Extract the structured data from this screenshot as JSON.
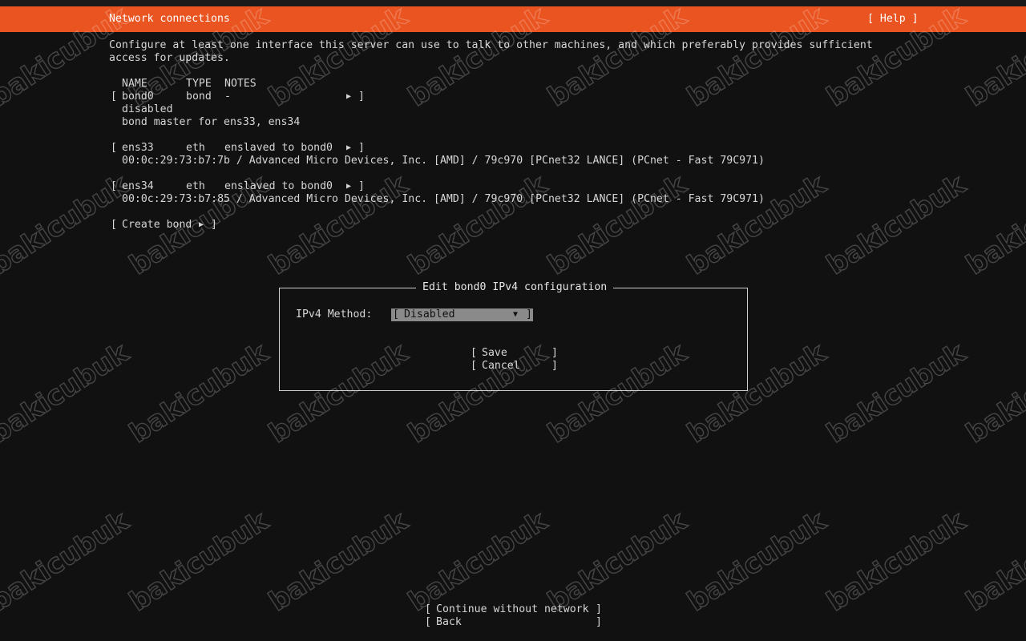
{
  "header": {
    "title": "Network connections",
    "help": "[ Help ]"
  },
  "intro": {
    "line1": "Configure at least one interface this server can use to talk to other machines, and which preferably provides sufficient",
    "line2": "access for updates."
  },
  "columns": {
    "name": "NAME",
    "type": "TYPE",
    "notes": "NOTES"
  },
  "interfaces": [
    {
      "name": "bond0",
      "type": "bond",
      "notes": "-",
      "status": "disabled",
      "detail": "bond master for ens33, ens34"
    },
    {
      "name": "ens33",
      "type": "eth",
      "notes": "enslaved to bond0",
      "detail": "00:0c:29:73:b7:7b / Advanced Micro Devices, Inc. [AMD] / 79c970 [PCnet32 LANCE] (PCnet - Fast 79C971)"
    },
    {
      "name": "ens34",
      "type": "eth",
      "notes": "enslaved to bond0",
      "detail": "00:0c:29:73:b7:85 / Advanced Micro Devices, Inc. [AMD] / 79c970 [PCnet32 LANCE] (PCnet - Fast 79C971)"
    }
  ],
  "create_bond": "Create bond",
  "dialog": {
    "title": "Edit bond0 IPv4 configuration",
    "method_label": "IPv4 Method:",
    "method_value": "Disabled",
    "save_label": "Save",
    "cancel_label": "Cancel"
  },
  "footer": {
    "continue_label": "Continue without network",
    "back_label": "Back"
  },
  "watermark": "bakicubuk",
  "colors": {
    "accent": "#e95420",
    "background": "#111111",
    "selected": "#8a8a8a"
  }
}
